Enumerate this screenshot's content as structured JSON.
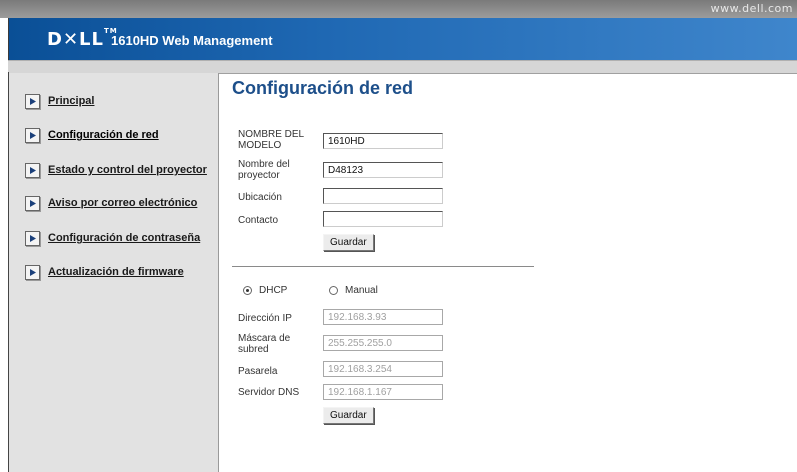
{
  "header": {
    "url_text": "www.dell.com",
    "logo_text": "D✕LL",
    "logo_tm": "TM",
    "title": "1610HD Web Management"
  },
  "sidebar": {
    "items": [
      {
        "label": "Principal",
        "icon": "arrow-right-icon"
      },
      {
        "label": "Configuración de red",
        "icon": "arrow-right-icon",
        "active": true
      },
      {
        "label": "Estado y control del proyector",
        "icon": "arrow-right-icon"
      },
      {
        "label": "Aviso por correo electrónico",
        "icon": "arrow-right-icon"
      },
      {
        "label": "Configuración de contraseña",
        "icon": "arrow-right-icon"
      },
      {
        "label": "Actualización de firmware",
        "icon": "arrow-right-icon"
      }
    ]
  },
  "main": {
    "title": "Configuración de red",
    "device_form": {
      "model_label": "NOMBRE DEL MODELO",
      "model_value": "1610HD",
      "projector_label": "Nombre del proyector",
      "projector_value": "D48123",
      "location_label": "Ubicación",
      "location_value": "",
      "contact_label": "Contacto",
      "contact_value": "",
      "save_label": "Guardar"
    },
    "network_form": {
      "dhcp_label": "DHCP",
      "manual_label": "Manual",
      "selected_mode": "DHCP",
      "ip_label": "Dirección IP",
      "ip_value": "192.168.3.93",
      "mask_label": "Máscara de subred",
      "mask_value": "255.255.255.0",
      "gateway_label": "Pasarela",
      "gateway_value": "192.168.3.254",
      "dns_label": "Servidor DNS",
      "dns_value": "192.168.1.167",
      "save_label": "Guardar"
    }
  },
  "colors": {
    "banner_start": "#0a4f96",
    "banner_end": "#3f86cc",
    "title_color": "#1d4f8a",
    "sidebar_bg": "#e2e2e2"
  }
}
